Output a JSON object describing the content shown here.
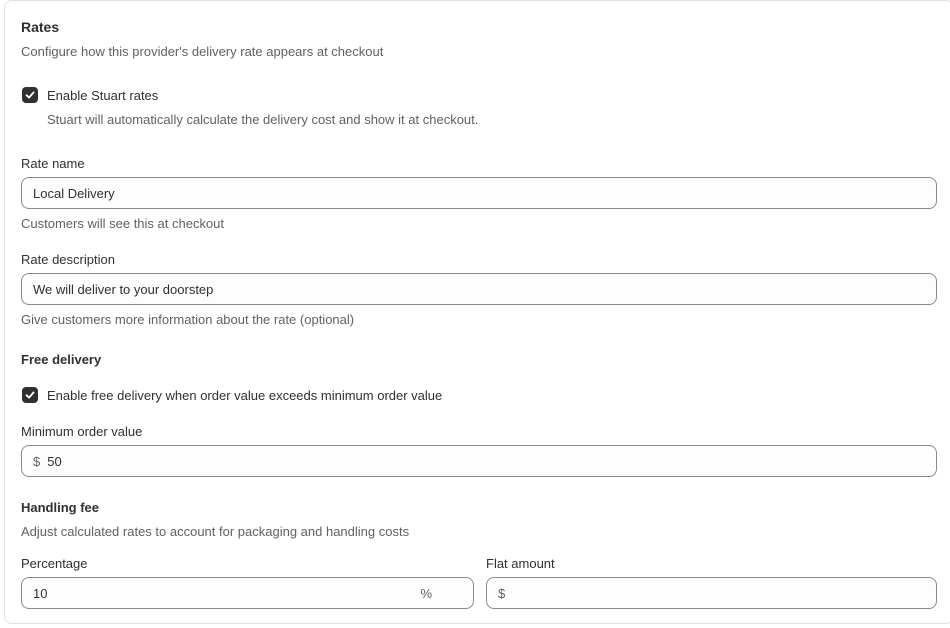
{
  "rates": {
    "title": "Rates",
    "subtitle": "Configure how this provider's delivery rate appears at checkout",
    "enable": {
      "label": "Enable Stuart rates",
      "help": "Stuart will automatically calculate the delivery cost and show it at checkout.",
      "checked": true
    },
    "rate_name": {
      "label": "Rate name",
      "value": "Local Delivery",
      "help": "Customers will see this at checkout"
    },
    "rate_description": {
      "label": "Rate description",
      "value": "We will deliver to your doorstep",
      "help": "Give customers more information about the rate (optional)"
    }
  },
  "free_delivery": {
    "title": "Free delivery",
    "enable_label": "Enable free delivery when order value exceeds minimum order value",
    "checked": true,
    "min_order": {
      "label": "Minimum order value",
      "prefix": "$",
      "value": "50"
    }
  },
  "handling_fee": {
    "title": "Handling fee",
    "subtitle": "Adjust calculated rates to account for packaging and handling costs",
    "percentage": {
      "label": "Percentage",
      "value": "10",
      "suffix": "%"
    },
    "flat_amount": {
      "label": "Flat amount",
      "prefix": "$",
      "value": ""
    }
  },
  "icons": {
    "checkbox": "checkmark-icon"
  },
  "colors": {
    "checkbox_fill": "#303030",
    "border": "#8a8a8a",
    "muted_text": "#616161"
  }
}
